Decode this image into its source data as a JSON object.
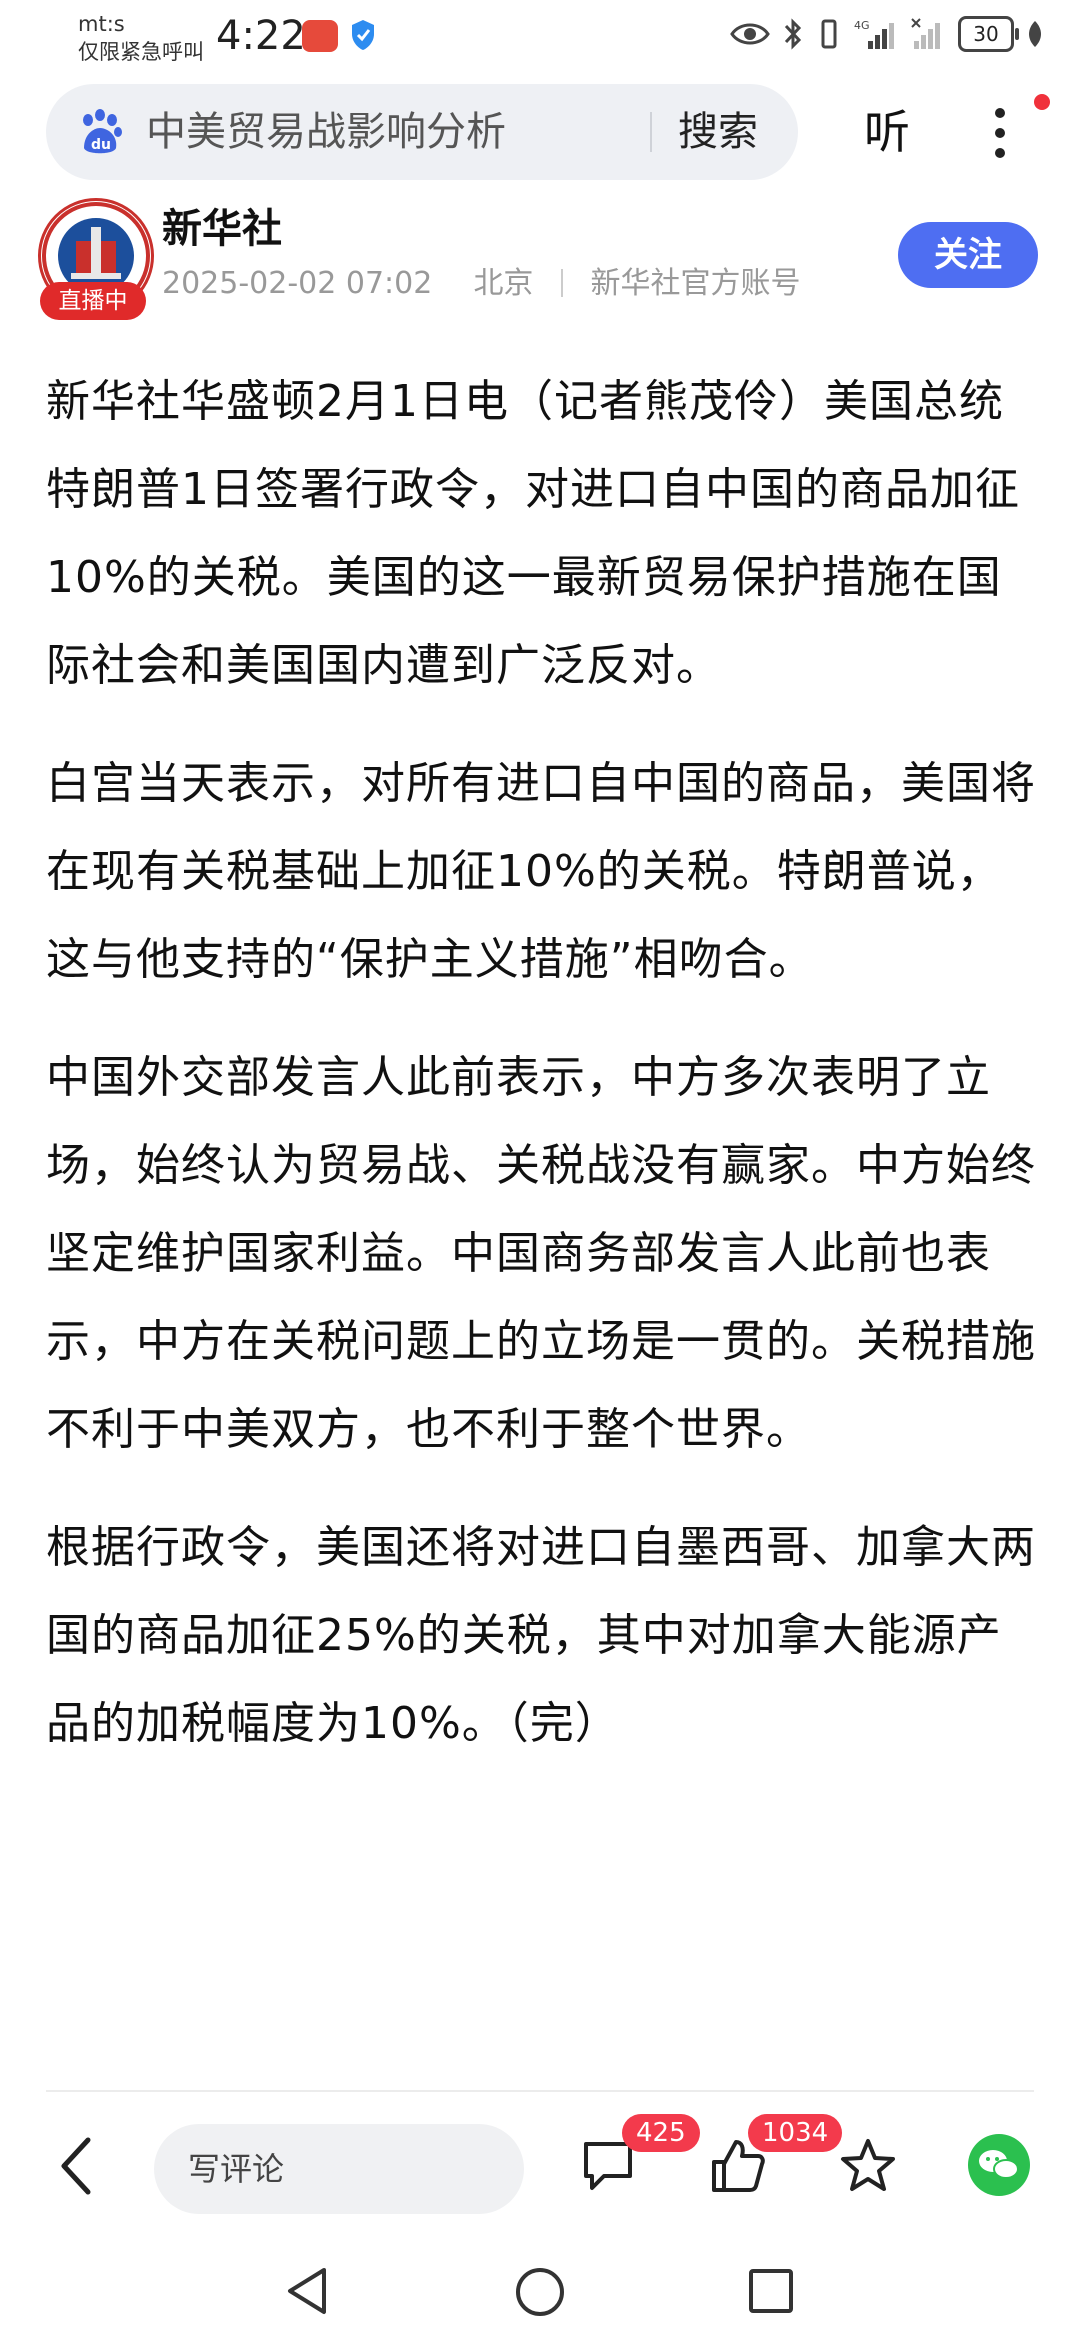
{
  "status_bar": {
    "carrier_line1": "mt:s",
    "carrier_line2": "仅限紧急呼叫",
    "time": "4:22",
    "battery": "30"
  },
  "search": {
    "query": "中美贸易战影响分析",
    "button_label": "搜索",
    "listen_label": "听"
  },
  "author": {
    "name": "新华社",
    "live_badge": "直播中",
    "date": "2025-02-02 07:02",
    "location": "北京",
    "account_type": "新华社官方账号",
    "follow_label": "关注"
  },
  "article": {
    "paragraphs": [
      "新华社华盛顿2月1日电（记者熊茂伶）美国总统特朗普1日签署行政令，对进口自中国的商品加征10%的关税。美国的这一最新贸易保护措施在国际社会和美国国内遭到广泛反对。",
      "白宫当天表示，对所有进口自中国的商品，美国将在现有关税基础上加征10%的关税。特朗普说，这与他支持的“保护主义措施”相吻合。",
      "中国外交部发言人此前表示，中方多次表明了立场，始终认为贸易战、关税战没有赢家。中方始终坚定维护国家利益。中国商务部发言人此前也表示，中方在关税问题上的立场是一贯的。关税措施不利于中美双方，也不利于整个世界。",
      "根据行政令，美国还将对进口自墨西哥、加拿大两国的商品加征25%的关税，其中对加拿大能源产品的加税幅度为10%。（完）"
    ]
  },
  "bottom_bar": {
    "comment_placeholder": "写评论",
    "comment_count": "425",
    "like_count": "1034"
  },
  "colors": {
    "accent": "#4e6ef2",
    "badge_red": "#f33a4c",
    "wechat_green": "#2bc04f"
  }
}
